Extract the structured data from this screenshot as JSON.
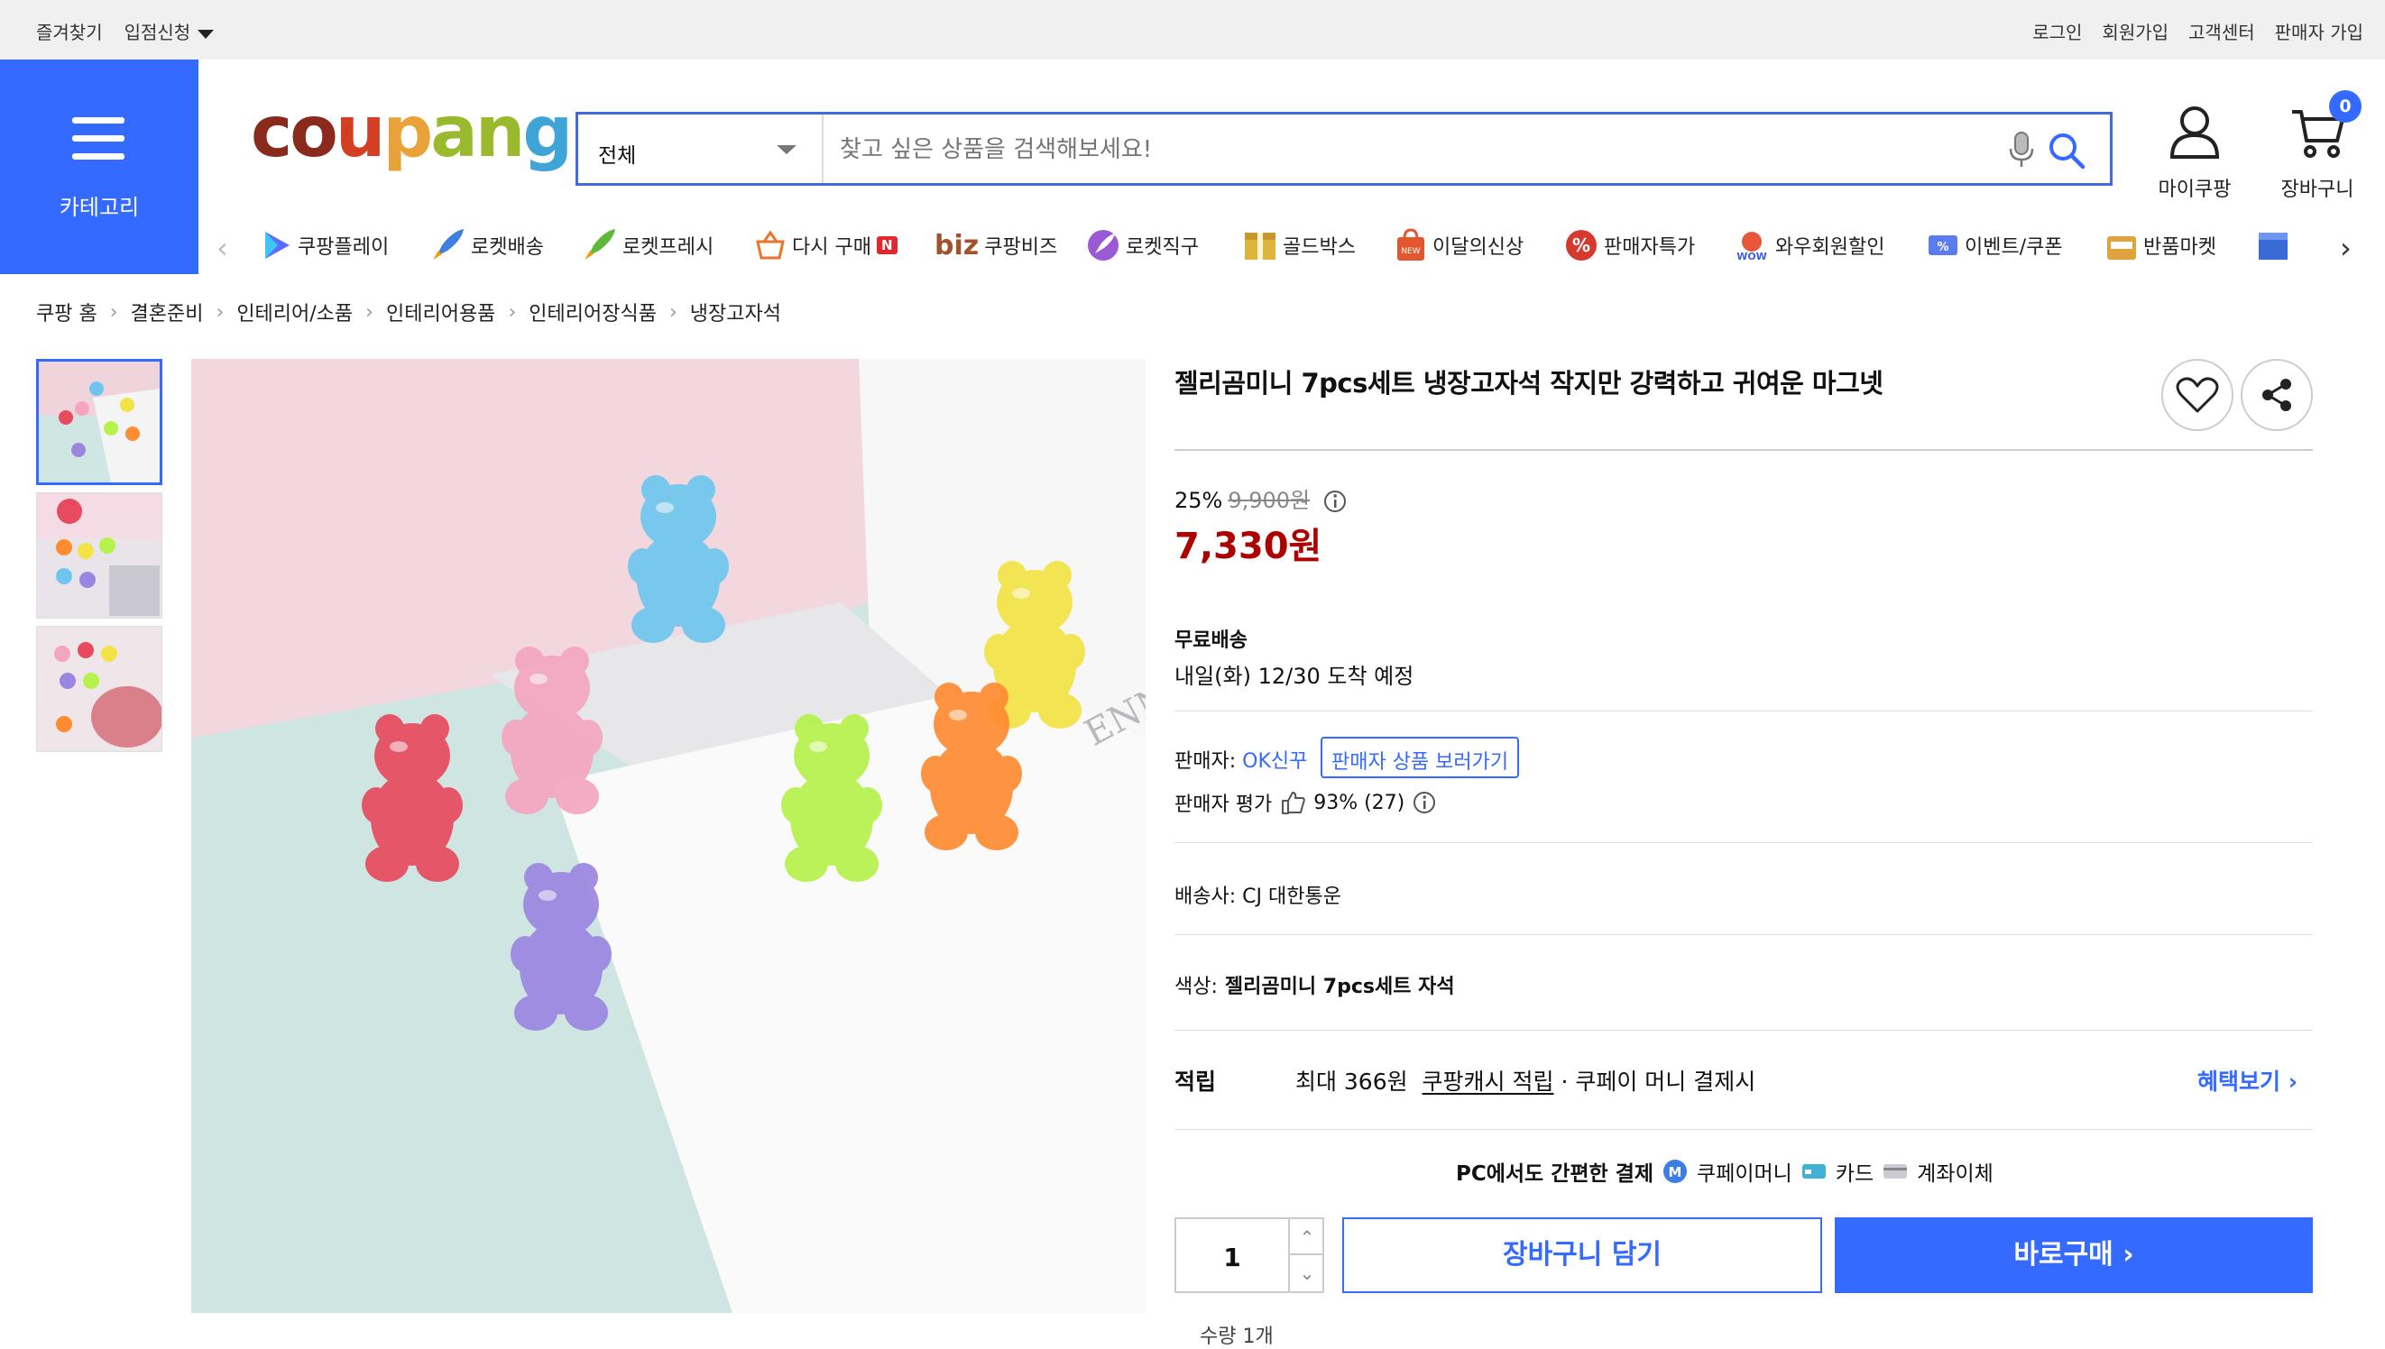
{
  "topbar": {
    "left": [
      "즐겨찾기",
      "입점신청"
    ],
    "right": [
      "로그인",
      "회원가입",
      "고객센터",
      "판매자 가입"
    ]
  },
  "category_label": "카테고리",
  "logo_text": "coupang",
  "search": {
    "category": "전체",
    "placeholder": "찾고 싶은 상품을 검색해보세요!"
  },
  "header": {
    "mycoupang": "마이쿠팡",
    "cart": "장바구니",
    "cart_count": "0"
  },
  "nav": [
    {
      "label": "쿠팡플레이",
      "icon": "play-icon",
      "color": "#5b6cff"
    },
    {
      "label": "로켓배송",
      "icon": "rocket-icon",
      "color": "#3f7fe0"
    },
    {
      "label": "로켓프레시",
      "icon": "rocket-fresh-icon",
      "color": "#5fb83a"
    },
    {
      "label": "다시 구매",
      "icon": "basket-icon",
      "color": "#e9742c",
      "badge": "N"
    },
    {
      "label": "쿠팡비즈",
      "icon": "biz-icon",
      "color": "#a0522d",
      "prefix": "biz"
    },
    {
      "label": "로켓직구",
      "icon": "globe-rocket-icon",
      "color": "#9b59d6"
    },
    {
      "label": "골드박스",
      "icon": "goldbox-icon",
      "color": "#e0b43c"
    },
    {
      "label": "이달의신상",
      "icon": "new-bag-icon",
      "color": "#e4572e"
    },
    {
      "label": "판매자특가",
      "icon": "percent-icon",
      "color": "#d63a2f"
    },
    {
      "label": "와우회원할인",
      "icon": "wow-icon",
      "color": "#e8573a"
    },
    {
      "label": "이벤트/쿠폰",
      "icon": "coupon-icon",
      "color": "#5a7cf0"
    },
    {
      "label": "반품마켓",
      "icon": "sale-bag-icon",
      "color": "#e0a23c"
    }
  ],
  "breadcrumb": [
    "쿠팡 홈",
    "결혼준비",
    "인테리어/소품",
    "인테리어용품",
    "인테리어장식품",
    "냉장고자석"
  ],
  "product": {
    "title": "젤리곰미니 7pcs세트 냉장고자석 작지만 강력하고 귀여운 마그넷",
    "discount_rate": "25%",
    "original_price": "9,900원",
    "price": "7,330원",
    "shipping_title": "무료배송",
    "shipping_eta": "내일(화) 12/30 도착 예정",
    "seller_label": "판매자:",
    "seller_name": "OK신꾸",
    "seller_btn": "판매자 상품 보러가기",
    "rating_label": "판매자 평가",
    "rating_value": "93% (27)",
    "courier_label": "배송사:",
    "courier_name": "CJ 대한통운",
    "color_label": "색상:",
    "color_value": "젤리곰미니 7pcs세트 자석",
    "reward_title": "적립",
    "reward_amount": "최대 366원",
    "reward_link": "쿠팡캐시 적립",
    "reward_note": "· 쿠페이 머니 결제시",
    "benefit_link": "혜택보기",
    "pc_pay": "PC에서도 간편한 결제",
    "pay_methods": [
      "쿠페이머니",
      "카드",
      "계좌이체"
    ],
    "quantity": "1",
    "cart_btn": "장바구니 담기",
    "buy_btn": "바로구매"
  },
  "image_text": "ENNY'S D",
  "bears": [
    {
      "color": "#e84a5f"
    },
    {
      "color": "#f4a6c0"
    },
    {
      "color": "#6ec6ee"
    },
    {
      "color": "#f3e347"
    },
    {
      "color": "#b6f24c"
    },
    {
      "color": "#ff8c32"
    },
    {
      "color": "#9a86e0"
    }
  ],
  "partial_text": "수량 1개"
}
